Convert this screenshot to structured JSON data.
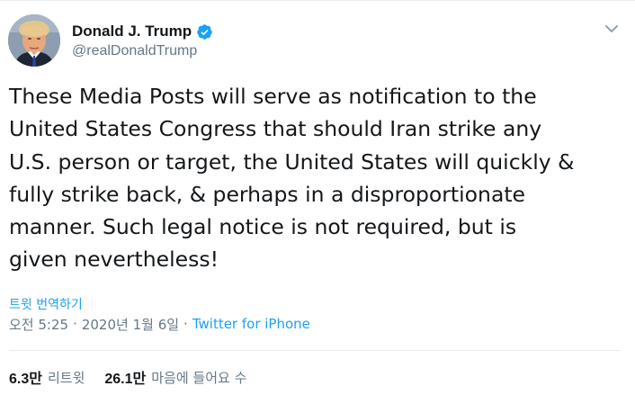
{
  "tweet": {
    "author": {
      "display_name": "Donald J. Trump",
      "handle": "@realDonaldTrump",
      "verified": true,
      "verified_icon": "verified-badge-icon",
      "avatar_icon": "profile-photo"
    },
    "menu_icon": "chevron-down-icon",
    "text": "These Media Posts will serve as notification to the\nUnited States Congress that should Iran strike any\nU.S. person or target, the United States will quickly &\nfully strike back, & perhaps in a disproportionate\nmanner. Such legal notice is not required, but is\ngiven nevertheless!",
    "translate_label": "트윗 번역하기",
    "meta": {
      "time": "오전 5:25",
      "separator": "·",
      "date": "2020년 1월 6일",
      "source": "Twitter for iPhone"
    },
    "stats": {
      "retweets_count": "6.3만",
      "retweets_label": "리트윗",
      "likes_count": "26.1만",
      "likes_label": "마음에 들어요 수"
    }
  },
  "colors": {
    "link": "#1da1f2",
    "secondary_text": "#657786",
    "primary_text": "#14171a",
    "border": "#e6ecf0"
  }
}
